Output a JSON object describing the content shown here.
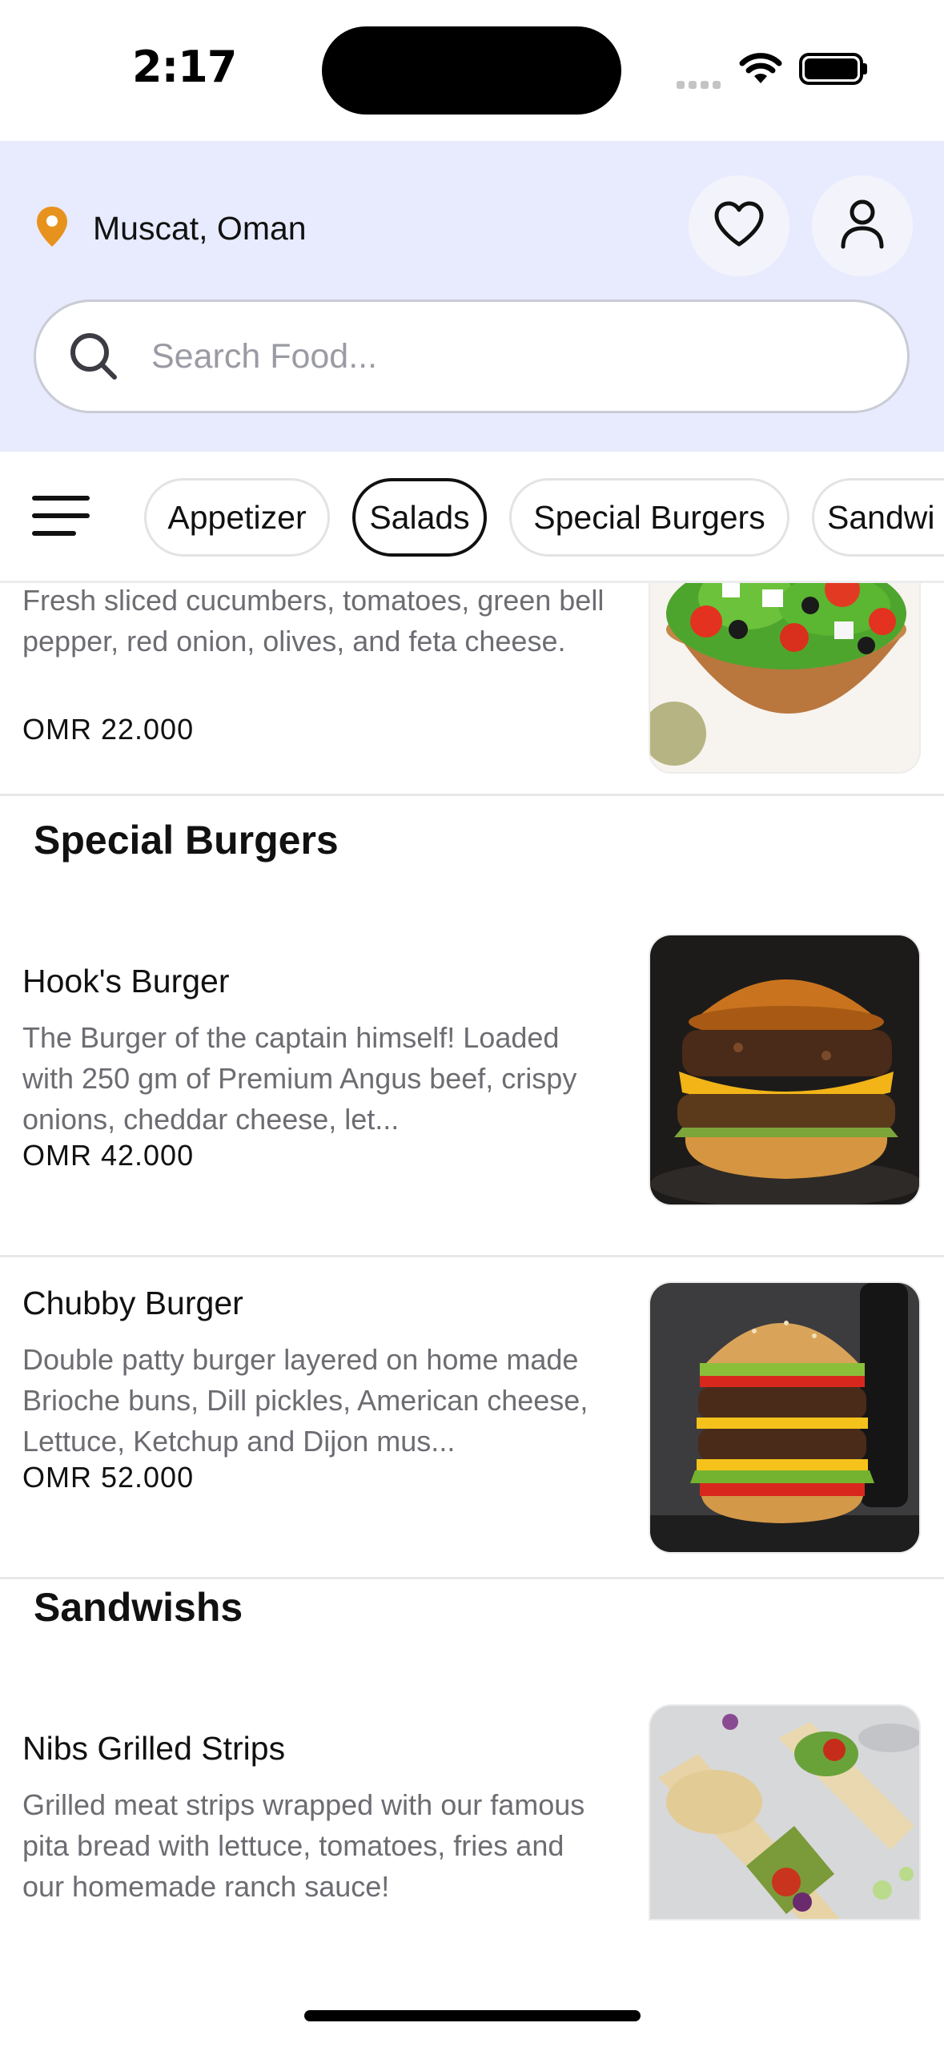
{
  "status_bar": {
    "time": "2:17"
  },
  "header": {
    "location": "Muscat, Oman",
    "search_placeholder": "Search Food..."
  },
  "categories": [
    {
      "label": "Appetizer",
      "active": false
    },
    {
      "label": "Salads",
      "active": true
    },
    {
      "label": "Special Burgers",
      "active": false
    },
    {
      "label": "Sandwi",
      "active": false
    }
  ],
  "items": {
    "greek_salad": {
      "description": "Fresh sliced cucumbers, tomatoes, green bell pepper, red onion, olives, and feta cheese.",
      "price": "OMR 22.000"
    },
    "special_burgers_title": "Special Burgers",
    "hooks_burger": {
      "name": "Hook's Burger",
      "description": "The Burger of the captain himself! Loaded with 250 gm of Premium Angus beef, crispy onions, cheddar cheese, let...",
      "price": "OMR 42.000"
    },
    "chubby_burger": {
      "name": "Chubby Burger",
      "description": "Double patty burger layered on home made Brioche buns, Dill pickles, American cheese, Lettuce, Ketchup and Dijon mus...",
      "price": "OMR 52.000"
    },
    "sandwishs_title": "Sandwishs",
    "nibs_grilled_strips": {
      "name": "Nibs Grilled Strips",
      "description": "Grilled meat strips wrapped with our famous pita bread with lettuce, tomatoes, fries and our homemade ranch sauce!"
    }
  },
  "colors": {
    "header_bg": "#e7ebfd",
    "pin": "#e8921e",
    "active_chip_border": "#111111"
  },
  "icons": [
    "location-pin-icon",
    "heart-icon",
    "user-icon",
    "search-icon",
    "hamburger-menu-icon",
    "wifi-icon",
    "battery-icon"
  ]
}
